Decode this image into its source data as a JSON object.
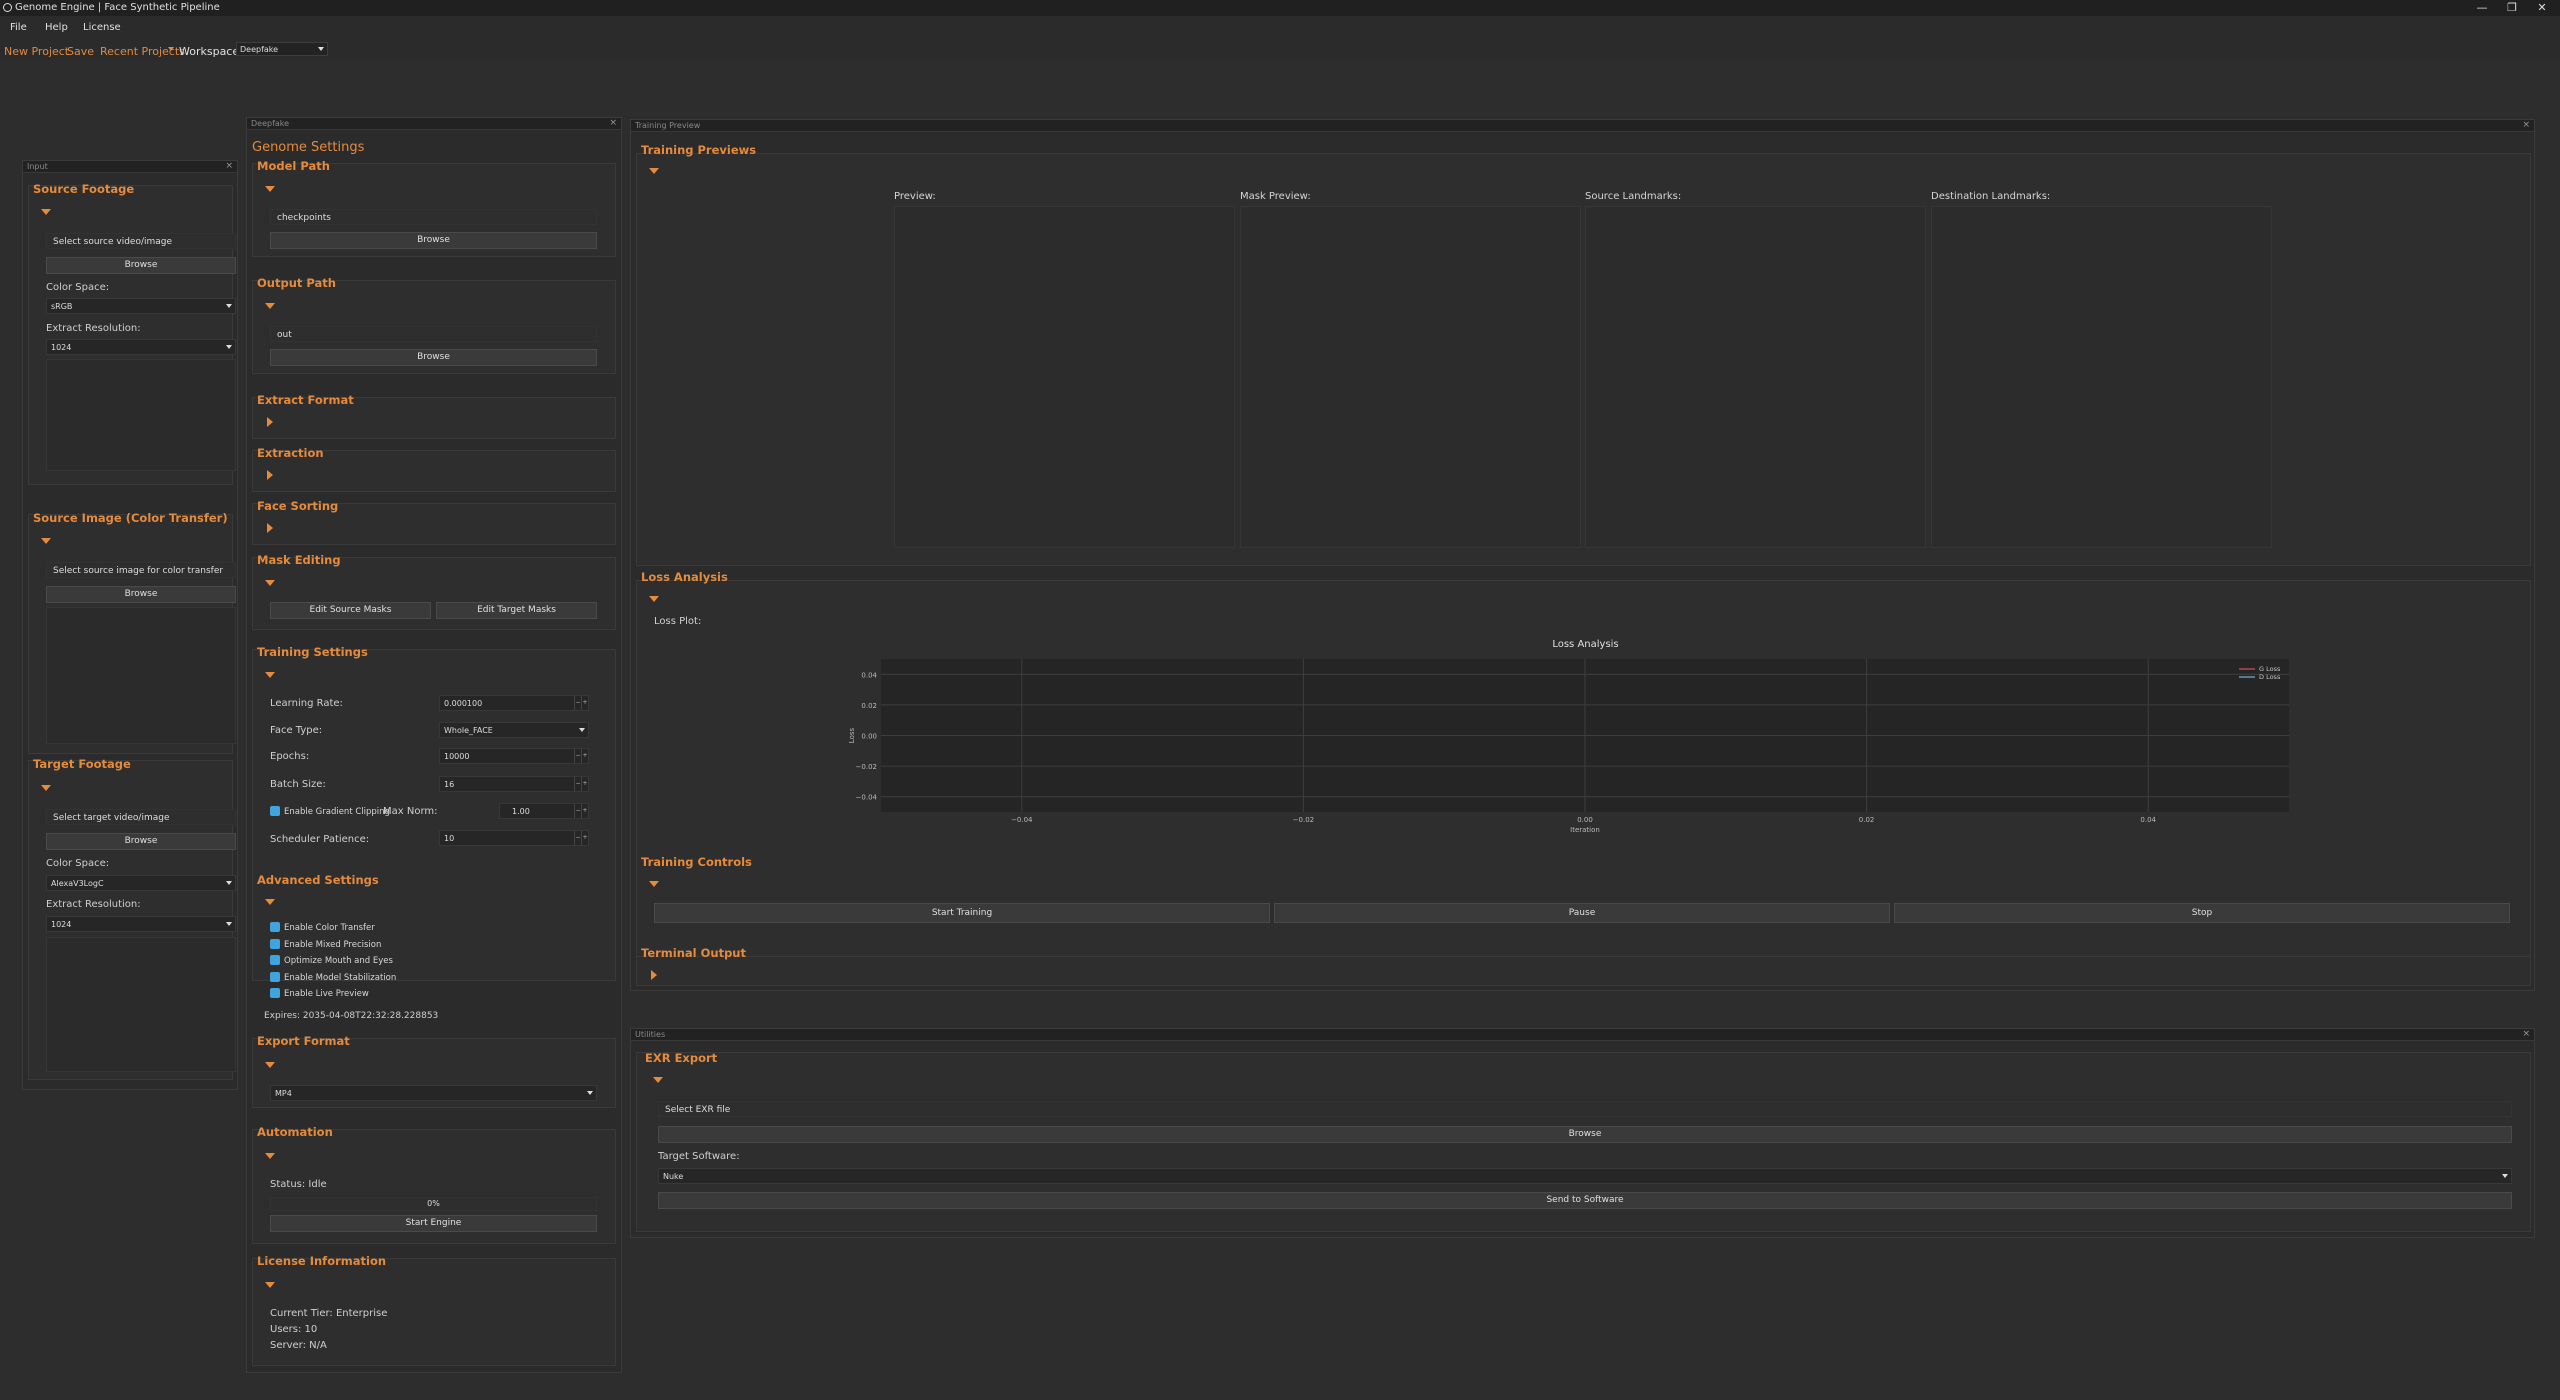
{
  "window": {
    "title": "Genome Engine | Face Synthetic Pipeline",
    "minimize": "—",
    "restore": "❐",
    "close": "✕"
  },
  "menu": [
    "File",
    "Help",
    "License"
  ],
  "toolbar": {
    "new_project": "New Project",
    "save": "Save",
    "recent_projects": "Recent Projects",
    "workspace_label": "Workspace:",
    "workspace_value": "Deepfake"
  },
  "input_panel": {
    "title": "Input",
    "close": "×",
    "source_footage": {
      "header": "Source Footage",
      "placeholder": "Select source video/image",
      "browse": "Browse",
      "color_space_label": "Color Space:",
      "color_space": "sRGB",
      "extract_res_label": "Extract Resolution:",
      "extract_res": "1024"
    },
    "source_image": {
      "header": "Source Image (Color Transfer)",
      "placeholder": "Select source image for color transfer",
      "browse": "Browse"
    },
    "target_footage": {
      "header": "Target Footage",
      "placeholder": "Select target video/image",
      "browse": "Browse",
      "color_space_label": "Color Space:",
      "color_space": "AlexaV3LogC",
      "extract_res_label": "Extract Resolution:",
      "extract_res": "1024"
    }
  },
  "deepfake_panel": {
    "title": "Deepfake",
    "close": "×",
    "heading": "Genome Settings",
    "model_path": {
      "header": "Model Path",
      "value": "checkpoints",
      "browse": "Browse"
    },
    "output_path": {
      "header": "Output Path",
      "value": "out",
      "browse": "Browse"
    },
    "extract_format": {
      "header": "Extract Format"
    },
    "extraction": {
      "header": "Extraction"
    },
    "face_sorting": {
      "header": "Face Sorting"
    },
    "mask_editing": {
      "header": "Mask Editing",
      "edit_source": "Edit Source Masks",
      "edit_target": "Edit Target Masks"
    },
    "training_settings": {
      "header": "Training Settings",
      "learning_rate_label": "Learning Rate:",
      "learning_rate": "0.000100",
      "face_type_label": "Face Type:",
      "face_type": "Whole_FACE",
      "epochs_label": "Epochs:",
      "epochs": "10000",
      "batch_label": "Batch Size:",
      "batch": "16",
      "grad_clip_label": "Enable Gradient Clipping",
      "max_norm_label": "Max Norm:",
      "max_norm": "1.00",
      "patience_label": "Scheduler Patience:",
      "patience": "10"
    },
    "advanced": {
      "header": "Advanced Settings",
      "options": [
        "Enable Color Transfer",
        "Enable Mixed Precision",
        "Optimize Mouth and Eyes",
        "Enable Model Stabilization",
        "Enable Live Preview"
      ],
      "expires": "Expires: 2035-04-08T22:32:28.228853"
    },
    "export_format": {
      "header": "Export Format",
      "value": "MP4"
    },
    "automation": {
      "header": "Automation",
      "status": "Status: Idle",
      "progress": 0,
      "progress_text": "0%",
      "start": "Start Engine"
    },
    "license": {
      "header": "License Information",
      "tier": "Current Tier: Enterprise",
      "users": "Users: 10",
      "server": "Server: N/A"
    }
  },
  "training_panel": {
    "title": "Training Preview",
    "close": "×",
    "previews": {
      "header": "Training Previews",
      "labels": [
        "Preview:",
        "Mask Preview:",
        "Source Landmarks:",
        "Destination Landmarks:"
      ]
    },
    "loss": {
      "header": "Loss Analysis",
      "plot_label": "Loss Plot:"
    },
    "controls": {
      "header": "Training Controls",
      "start": "Start Training",
      "pause": "Pause",
      "stop": "Stop"
    },
    "terminal": {
      "header": "Terminal Output"
    }
  },
  "utilities_panel": {
    "title": "Utilities",
    "close": "×",
    "exr": {
      "header": "EXR Export",
      "placeholder": "Select EXR file",
      "browse": "Browse",
      "target_label": "Target Software:",
      "target": "Nuke",
      "send": "Send to Software"
    }
  },
  "chart_data": {
    "type": "line",
    "title": "Loss Analysis",
    "xlabel": "Iteration",
    "ylabel": "Loss",
    "xlim": [
      -0.05,
      0.05
    ],
    "ylim": [
      -0.05,
      0.05
    ],
    "xticks": [
      "−0.04",
      "−0.02",
      "0.00",
      "0.02",
      "0.04"
    ],
    "yticks": [
      "0.04",
      "0.02",
      "0.00",
      "−0.02",
      "−0.04"
    ],
    "grid": true,
    "legend": "top-right",
    "series": [
      {
        "name": "G Loss",
        "color": "#d9534f",
        "x": [],
        "y": []
      },
      {
        "name": "D Loss",
        "color": "#7fb3e0",
        "x": [],
        "y": []
      }
    ]
  }
}
